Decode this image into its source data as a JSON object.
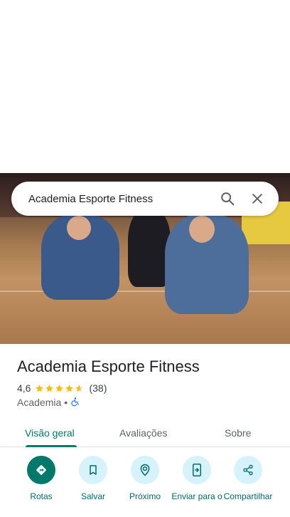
{
  "search": {
    "query": "Academia Esporte Fitness"
  },
  "place": {
    "name": "Academia Esporte Fitness",
    "rating": "4,6",
    "rating_value": 4.6,
    "review_count": "(38)",
    "category": "Academia",
    "separator": "•"
  },
  "tabs": [
    {
      "label": "Visão geral",
      "active": true
    },
    {
      "label": "Avaliações",
      "active": false
    },
    {
      "label": "Sobre",
      "active": false
    }
  ],
  "actions": [
    {
      "label": "Rotas",
      "icon": "directions-icon"
    },
    {
      "label": "Salvar",
      "icon": "bookmark-icon"
    },
    {
      "label": "Próximo",
      "icon": "nearby-icon"
    },
    {
      "label": "Enviar para o",
      "icon": "send-to-phone-icon"
    },
    {
      "label": "Compartilhar",
      "icon": "share-icon"
    }
  ],
  "colors": {
    "accent": "#00796b",
    "star": "#fbbc04",
    "action_bg": "#d6f3fb",
    "accessibility": "#1a73e8"
  }
}
